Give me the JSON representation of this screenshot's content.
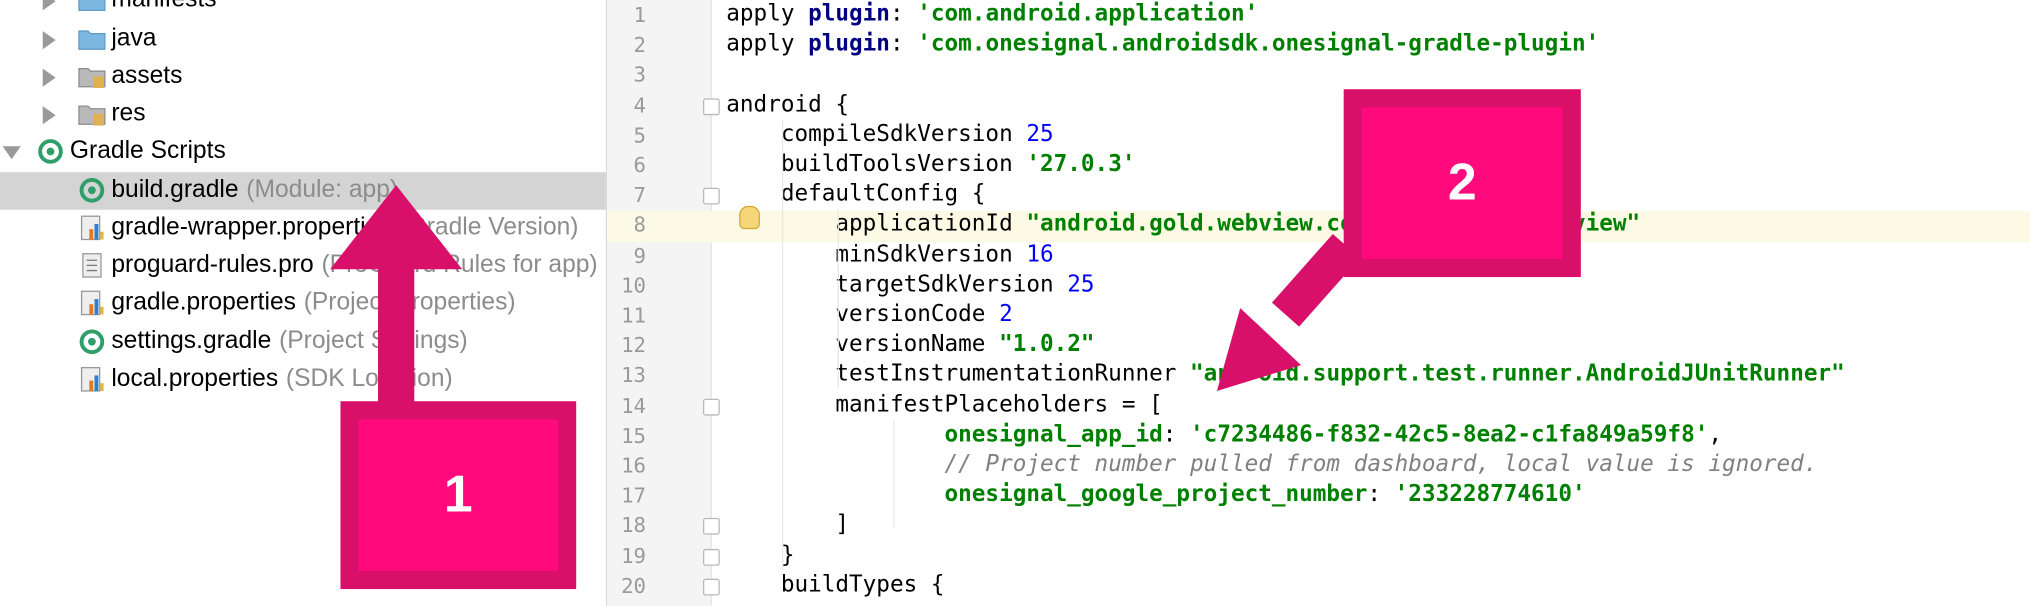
{
  "project_tree": {
    "items": [
      {
        "label": "manifests",
        "hint": "",
        "icon": "folder-icon",
        "arrow": "collapsed"
      },
      {
        "label": "java",
        "hint": "",
        "icon": "folder-icon",
        "arrow": "collapsed"
      },
      {
        "label": "assets",
        "hint": "",
        "icon": "resource-folder-icon",
        "arrow": "collapsed"
      },
      {
        "label": "res",
        "hint": "",
        "icon": "resource-folder-icon",
        "arrow": "collapsed"
      },
      {
        "label": "Gradle Scripts",
        "hint": "",
        "icon": "gradle-icon",
        "arrow": "expanded"
      },
      {
        "label": "build.gradle",
        "hint": "(Module: app)",
        "icon": "gradle-icon",
        "arrow": "none",
        "selected": true
      },
      {
        "label": "gradle-wrapper.properties",
        "hint": "(Gradle Version)",
        "icon": "properties-file-icon",
        "arrow": "none"
      },
      {
        "label": "proguard-rules.pro",
        "hint": "(ProGuard Rules for app)",
        "icon": "text-file-icon",
        "arrow": "none"
      },
      {
        "label": "gradle.properties",
        "hint": "(Project Properties)",
        "icon": "properties-file-icon",
        "arrow": "none"
      },
      {
        "label": "settings.gradle",
        "hint": "(Project Settings)",
        "icon": "gradle-icon",
        "arrow": "none"
      },
      {
        "label": "local.properties",
        "hint": "(SDK Location)",
        "icon": "properties-file-icon",
        "arrow": "none"
      }
    ]
  },
  "editor": {
    "lines": [
      {
        "n": "1",
        "parts": [
          [
            "",
            "apply "
          ],
          [
            "kw",
            "plugin"
          ],
          [
            "",
            ": "
          ],
          [
            "str",
            "'com.android.application'"
          ]
        ]
      },
      {
        "n": "2",
        "parts": [
          [
            "",
            "apply "
          ],
          [
            "kw",
            "plugin"
          ],
          [
            "",
            ": "
          ],
          [
            "str",
            "'com.onesignal.androidsdk.onesignal-gradle-plugin'"
          ]
        ]
      },
      {
        "n": "3",
        "parts": []
      },
      {
        "n": "4",
        "parts": [
          [
            "",
            "android {"
          ]
        ],
        "fold": true
      },
      {
        "n": "5",
        "parts": [
          [
            "",
            "    compileSdkVersion "
          ],
          [
            "num",
            "25"
          ]
        ]
      },
      {
        "n": "6",
        "parts": [
          [
            "",
            "    buildToolsVersion "
          ],
          [
            "str",
            "'27.0.3'"
          ]
        ]
      },
      {
        "n": "7",
        "parts": [
          [
            "",
            "    defaultConfig {"
          ]
        ],
        "fold": true
      },
      {
        "n": "8",
        "parts": [
          [
            "",
            "        applicationId "
          ],
          [
            "str",
            "\"android.gold.webview.codecanyon.com.webview\""
          ]
        ],
        "highlight": true,
        "bulb": true
      },
      {
        "n": "9",
        "parts": [
          [
            "",
            "        minSdkVersion "
          ],
          [
            "num",
            "16"
          ]
        ]
      },
      {
        "n": "10",
        "parts": [
          [
            "",
            "        targetSdkVersion "
          ],
          [
            "num",
            "25"
          ]
        ]
      },
      {
        "n": "11",
        "parts": [
          [
            "",
            "        versionCode "
          ],
          [
            "num",
            "2"
          ]
        ]
      },
      {
        "n": "12",
        "parts": [
          [
            "",
            "        versionName "
          ],
          [
            "str",
            "\"1.0.2\""
          ]
        ]
      },
      {
        "n": "13",
        "parts": [
          [
            "",
            "        testInstrumentationRunner "
          ],
          [
            "str",
            "\"android.support.test.runner.AndroidJUnitRunner\""
          ]
        ]
      },
      {
        "n": "14",
        "parts": [
          [
            "",
            "        manifestPlaceholders = ["
          ]
        ],
        "fold": true
      },
      {
        "n": "15",
        "parts": [
          [
            "",
            "                "
          ],
          [
            "str",
            "onesignal_app_id"
          ],
          [
            "",
            ": "
          ],
          [
            "str",
            "'c7234486-f832-42c5-8ea2-c1fa849a59f8'"
          ],
          [
            "",
            ","
          ]
        ]
      },
      {
        "n": "16",
        "parts": [
          [
            "",
            "                "
          ],
          [
            "cmt",
            "// Project number pulled from dashboard, local value is ignored."
          ]
        ]
      },
      {
        "n": "17",
        "parts": [
          [
            "",
            "                "
          ],
          [
            "str",
            "onesignal_google_project_number"
          ],
          [
            "",
            ": "
          ],
          [
            "str",
            "'233228774610'"
          ]
        ]
      },
      {
        "n": "18",
        "parts": [
          [
            "",
            "        ]"
          ]
        ],
        "fold": true
      },
      {
        "n": "19",
        "parts": [
          [
            "",
            "    }"
          ]
        ],
        "fold": true
      },
      {
        "n": "20",
        "parts": [
          [
            "",
            "    buildTypes {"
          ]
        ],
        "fold": true
      }
    ]
  },
  "callouts": {
    "first": "1",
    "second": "2"
  },
  "colors": {
    "callout_fill": "#ff0a7d",
    "callout_border": "#d8106a",
    "keyword": "#000080",
    "string": "#008000",
    "number": "#0000ff",
    "comment": "#808080"
  }
}
